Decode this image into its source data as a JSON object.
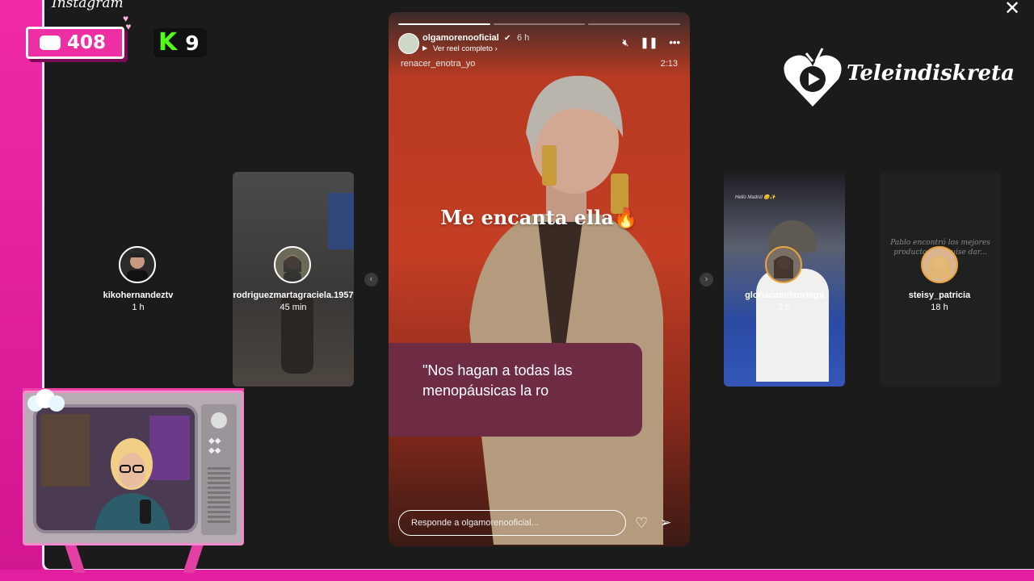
{
  "app": {
    "label": "Instagram",
    "close": "✕"
  },
  "stream": {
    "chat_count": "408",
    "kick_logo": "K",
    "kick_count": "9"
  },
  "story": {
    "username": "olgamorenooficial",
    "time": "6 h",
    "reel_link": "Ver reel completo",
    "audio": "renacer_enotra_yo",
    "duration": "2:13",
    "overlay_text": "Me encanta ella🔥",
    "quote_text": "\"Nos hagan a todas las menopáusicas la ro",
    "reply_placeholder": "Responde a olgamorenooficial...",
    "progress_segments": 3,
    "progress_done": 1
  },
  "side_stories": [
    {
      "user": "kikohernandeztv",
      "time": "1 h"
    },
    {
      "user": "rodriguezmartagraciela.1957",
      "time": "45 min"
    },
    {
      "user": "gloriacamilaortega",
      "time": "2 h"
    },
    {
      "user": "steisy_patricia",
      "time": "18 h"
    }
  ],
  "tile_texts": {
    "gloria_caption": "Hello Madrid 😊✨",
    "steisy_caption": "Pablo encontró los mejores productos... y quise dar... esa"
  },
  "logo": {
    "text": "Teleindiskreta"
  },
  "nav": {
    "prev": "‹",
    "next": "›"
  },
  "colors": {
    "accent": "#e21fa0",
    "kick_green": "#53fc18",
    "quote_bg": "#6e2c44"
  }
}
